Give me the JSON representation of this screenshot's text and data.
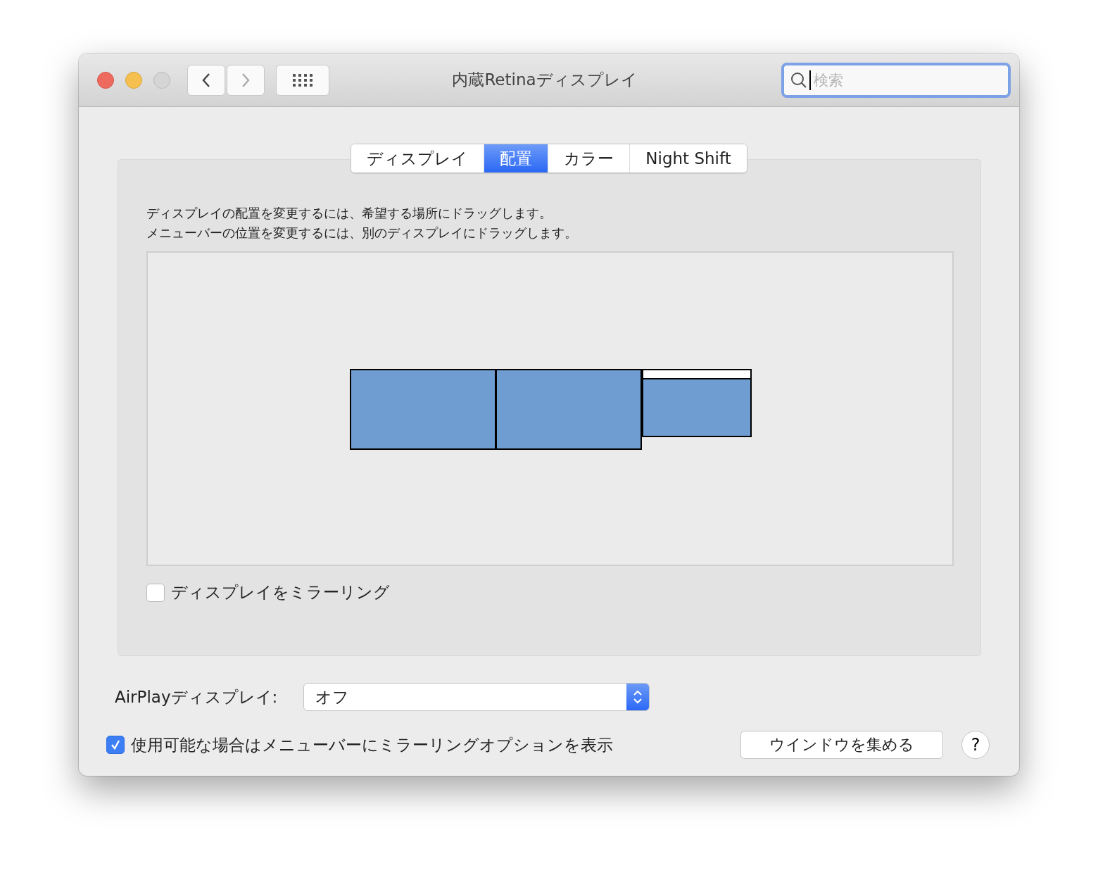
{
  "window": {
    "title": "内蔵Retinaディスプレイ"
  },
  "toolbar": {
    "back_enabled": true,
    "forward_enabled": false
  },
  "search": {
    "placeholder": "検索",
    "focused": true
  },
  "tabs": [
    {
      "label": "ディスプレイ",
      "selected": false
    },
    {
      "label": "配置",
      "selected": true
    },
    {
      "label": "カラー",
      "selected": false
    },
    {
      "label": "Night Shift",
      "selected": false
    }
  ],
  "instructions": [
    "ディスプレイの配置を変更するには、希望する場所にドラッグします。",
    "メニューバーの位置を変更するには、別のディスプレイにドラッグします。"
  ],
  "displays": [
    {
      "menu_bar": false
    },
    {
      "menu_bar": false
    },
    {
      "menu_bar": true
    }
  ],
  "mirror": {
    "label": "ディスプレイをミラーリング",
    "checked": false
  },
  "airplay": {
    "label": "AirPlayディスプレイ:",
    "value": "オフ"
  },
  "show_in_menu_bar": {
    "label": "使用可能な場合はメニューバーにミラーリングオプションを表示",
    "checked": true
  },
  "gather_button": "ウインドウを集める",
  "help_button": "?"
}
